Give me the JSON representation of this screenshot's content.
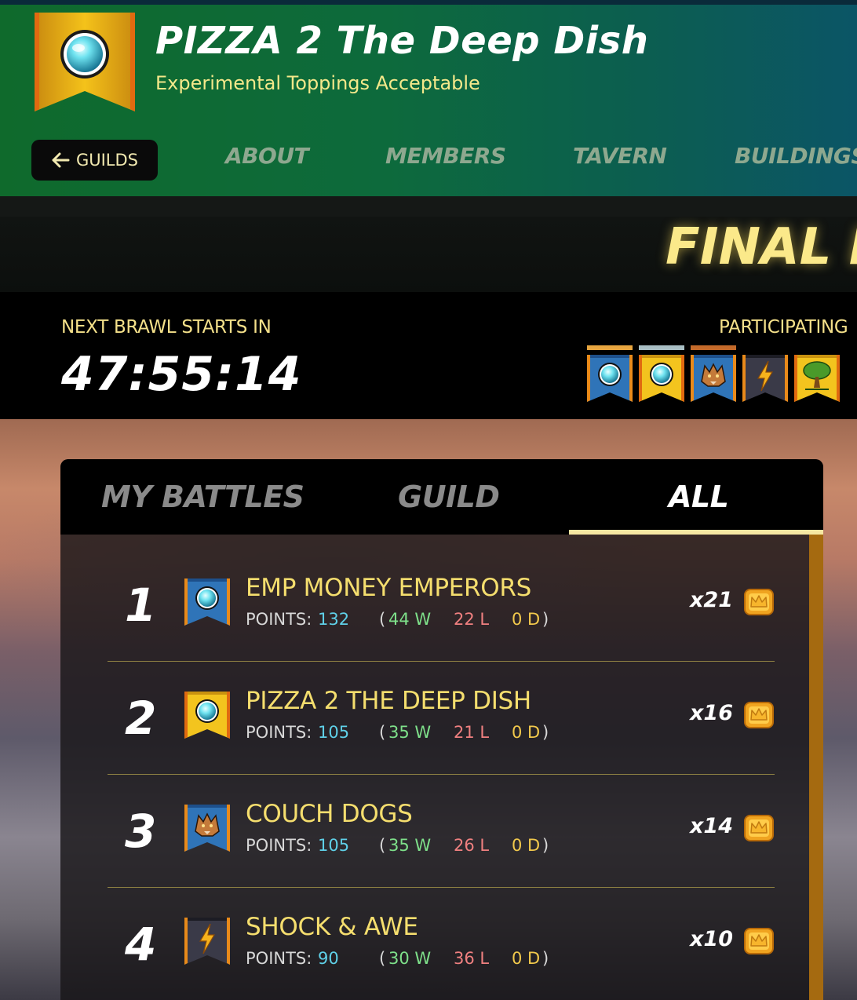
{
  "header": {
    "guild_name": "PIZZA 2 The Deep Dish",
    "motto": "Experimental Toppings Acceptable",
    "back_label": "GUILDS",
    "nav": [
      "ABOUT",
      "MEMBERS",
      "TAVERN",
      "BUILDINGS"
    ]
  },
  "final_results_label": "FINAL RE",
  "brawl": {
    "next_label": "NEXT BRAWL STARTS IN",
    "countdown": "47:55:14",
    "participating_label": "PARTICIPATING"
  },
  "participants": [
    {
      "emblem": "orb-icon",
      "style": "blue",
      "bar_color": "#e8a640"
    },
    {
      "emblem": "orb-icon",
      "style": "gold",
      "bar_color": "#a9bfc4"
    },
    {
      "emblem": "wolf-icon",
      "style": "blue",
      "bar_color": "#c46a2a"
    },
    {
      "emblem": "lightning-icon",
      "style": "dark",
      "bar_color": null
    },
    {
      "emblem": "tree-icon",
      "style": "gold",
      "bar_color": null
    }
  ],
  "tabs": {
    "my_battles": "MY BATTLES",
    "guild": "GUILD",
    "all": "ALL",
    "active": "ALL"
  },
  "results": [
    {
      "rank": "1",
      "name": "EMP MONEY EMPERORS",
      "points_label": "POINTS:",
      "points": "132",
      "wins": "44 W",
      "losses": "22 L",
      "draws": "0 D",
      "multiplier": "x21",
      "emblem": "orb-icon",
      "style": "blue"
    },
    {
      "rank": "2",
      "name": "PIZZA 2 THE DEEP DISH",
      "points_label": "POINTS:",
      "points": "105",
      "wins": "35 W",
      "losses": "21 L",
      "draws": "0 D",
      "multiplier": "x16",
      "emblem": "orb-icon",
      "style": "gold"
    },
    {
      "rank": "3",
      "name": "COUCH DOGS",
      "points_label": "POINTS:",
      "points": "105",
      "wins": "35 W",
      "losses": "26 L",
      "draws": "0 D",
      "multiplier": "x14",
      "emblem": "wolf-icon",
      "style": "blue"
    },
    {
      "rank": "4",
      "name": "SHOCK & AWE",
      "points_label": "POINTS:",
      "points": "90",
      "wins": "30 W",
      "losses": "36 L",
      "draws": "0 D",
      "multiplier": "x10",
      "emblem": "lightning-icon",
      "style": "dark"
    }
  ],
  "colors": {
    "header_green": "#0f6a2c",
    "gold_text": "#f5de6e",
    "points_blue": "#5fd0e8",
    "win_green": "#7ee08a",
    "loss_red": "#f08080",
    "draw_yellow": "#f2c94c",
    "tab_underline": "#f6e7a2"
  }
}
